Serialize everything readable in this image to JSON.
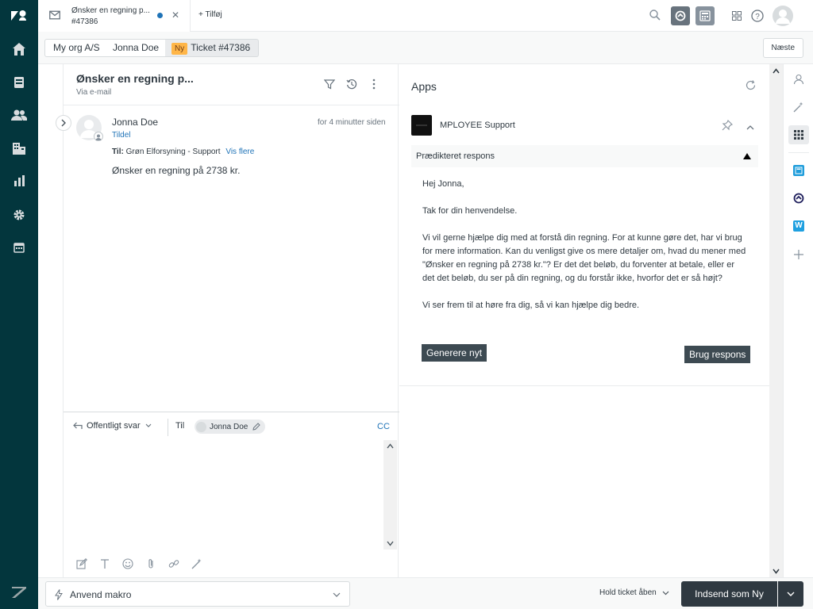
{
  "tab": {
    "title": "Ønsker en regning p...",
    "number": "#47386",
    "add_label": "+ Tilføj"
  },
  "breadcrumb": {
    "org": "My org A/S",
    "requester": "Jonna Doe",
    "status_badge": "Ny",
    "ticket": "Ticket #47386",
    "next_label": "Næste"
  },
  "conversation": {
    "title": "Ønsker en regning p...",
    "channel": "Via e-mail",
    "message": {
      "author": "Jonna Doe",
      "time": "for 4 minutter siden",
      "assign_link": "Tildel",
      "to_label": "Til:",
      "to_value": "Grøn Elforsyning - Support",
      "show_more": "Vis flere",
      "body": "Ønsker en regning på 2738 kr."
    }
  },
  "composer": {
    "reply_type": "Offentligt svar",
    "to_label": "Til",
    "recipient": "Jonna Doe",
    "cc_label": "CC"
  },
  "apps": {
    "title": "Apps",
    "app_name": "MPLOYEE Support",
    "section_label": "Prædikteret respons",
    "response": [
      "Hej Jonna,",
      "Tak for din henvendelse.",
      "Vi vil gerne hjælpe dig med at forstå din regning. For at kunne gøre det, har vi brug for mere information. Kan du venligst give os mere detaljer om, hvad du mener med \"Ønsker en regning på 2738 kr.\"? Er det det beløb, du forventer at betale, eller er det det beløb, du ser på din regning, og du forstår ikke, hvorfor det er så højt?",
      "Vi ser frem til at høre fra dig, så vi kan hjælpe dig bedre."
    ],
    "regenerate_label": "Generere nyt",
    "use_label": "Brug respons"
  },
  "footer": {
    "macro_label": "Anvend makro",
    "hold_label": "Hold ticket åben",
    "submit_label": "Indsend som Ny"
  },
  "colors": {
    "nav_bg": "#03363d",
    "accent": "#1f73b7",
    "badge": "#ffb648",
    "dark_button": "#3d4a52"
  }
}
